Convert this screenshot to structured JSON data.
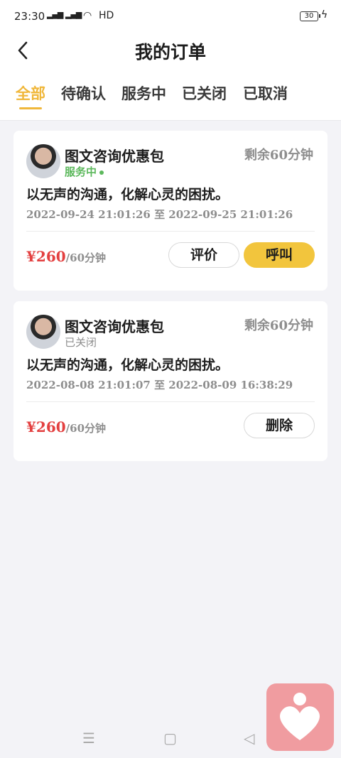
{
  "status_bar": {
    "time": "23:30",
    "network": "HD",
    "battery": "30"
  },
  "header": {
    "title": "我的订单"
  },
  "tabs": [
    {
      "label": "全部",
      "active": true
    },
    {
      "label": "待确认",
      "active": false
    },
    {
      "label": "服务中",
      "active": false
    },
    {
      "label": "已关闭",
      "active": false
    },
    {
      "label": "已取消",
      "active": false
    }
  ],
  "orders": [
    {
      "title": "图文咨询优惠包",
      "remaining": "剩余60分钟",
      "status": "服务中",
      "description": "以无声的沟通，化解心灵的困扰。",
      "time_range": "2022-09-24  21:01:26 至 2022-09-25  21:01:26",
      "price": "¥260",
      "price_unit": "/60分钟",
      "buttons": [
        "评价",
        "呼叫"
      ]
    },
    {
      "title": "图文咨询优惠包",
      "remaining": "剩余60分钟",
      "status": "已关闭",
      "description": "以无声的沟通，化解心灵的困扰。",
      "time_range": "2022-08-08  21:01:07 至 2022-08-09  16:38:29",
      "price": "¥260",
      "price_unit": "/60分钟",
      "buttons": [
        "删除"
      ]
    }
  ],
  "colors": {
    "accent": "#f0b73a",
    "call_button": "#f2c53d",
    "price": "#e34040",
    "status_active": "#5cb85c",
    "fab": "#f09ca0"
  },
  "icons": {
    "back": "chevron-left-icon",
    "fab": "heart-person-icon",
    "nav": [
      "menu-icon",
      "home-square-icon",
      "back-triangle-icon"
    ]
  }
}
